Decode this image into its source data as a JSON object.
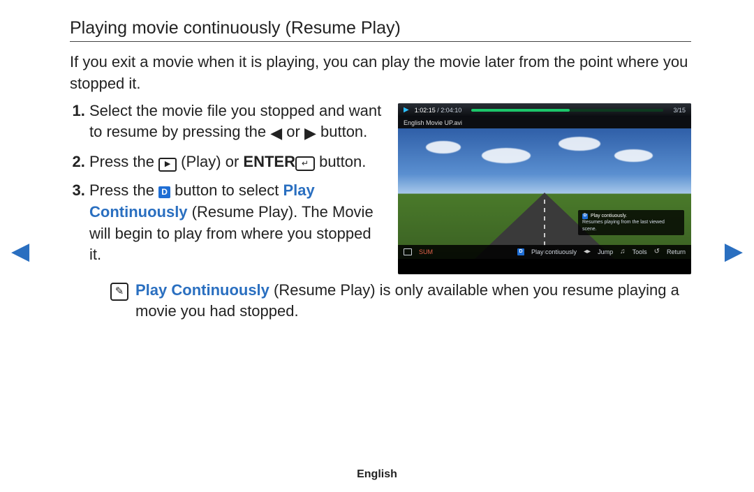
{
  "title": "Playing movie continuously (Resume Play)",
  "intro": "If you exit a movie when it is playing, you can play the movie later from the point where you stopped it.",
  "steps": {
    "s1_a": "Select the movie file you stopped and want to resume by pressing the ",
    "s1_b": " or ",
    "s1_c": " button.",
    "s2_a": "Press the ",
    "s2_b": " (Play) or ",
    "s2_enter": "ENTER",
    "s2_c": " button.",
    "s3_a": "Press the ",
    "s3_b": " button to select ",
    "s3_play_cont": "Play Continuously",
    "s3_c": " (Resume Play). The Movie will begin to play from where you stopped it."
  },
  "d_key_label": "D",
  "note": {
    "hl": "Play Continuously",
    "rest": " (Resume Play) is only available when you resume playing a movie you had stopped."
  },
  "footer_language": "English",
  "tv": {
    "time_elapsed": "1:02:15",
    "time_sep": " / ",
    "time_total": "2:04:10",
    "counter": "3/15",
    "filename": "English Movie UP.avi",
    "popup_title": "Play contiuously.",
    "popup_body": "Resumes playing from the last viewed scene.",
    "bar": {
      "sum": "SUM",
      "play_cont": "Play contiuously",
      "jump": "Jump",
      "tools": "Tools",
      "return": "Return"
    }
  }
}
